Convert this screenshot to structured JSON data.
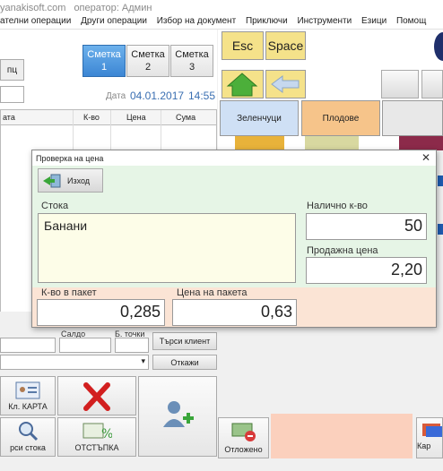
{
  "titlebar": {
    "site": "yanakisoft.com",
    "operator": "оператор: Админ"
  },
  "menu": {
    "items": [
      "ателни операции",
      "Други операции",
      "Избор на документ",
      "Приключи",
      "Инструменти",
      "Езици",
      "Помощ"
    ]
  },
  "left": {
    "pc_button": "пц",
    "accounts": [
      {
        "label": "Сметка",
        "num": "1"
      },
      {
        "label": "Сметка",
        "num": "2"
      },
      {
        "label": "Сметка",
        "num": "3"
      }
    ],
    "date_label": "Дата",
    "date": "04.01.2017",
    "time": "14:55",
    "grid_headers": [
      "ата",
      "К-во",
      "Цена",
      "Сума"
    ]
  },
  "keys": {
    "esc": "Esc",
    "space": "Space"
  },
  "categories": {
    "veg": "Зеленчуци",
    "fruit": "Плодове"
  },
  "dialog": {
    "title": "Проверка на цена",
    "exit_label": "Изход",
    "item_label": "Стока",
    "item_name": "Банани",
    "qty_label": "Налично к-во",
    "qty_value": "50",
    "price_label": "Продажна цена",
    "price_value": "2,20",
    "pack_qty_label": "К-во в пакет",
    "pack_qty_value": "0,285",
    "pack_price_label": "Цена на пакета",
    "pack_price_value": "0,63"
  },
  "client": {
    "saldo_label": "Салдо",
    "points_label": "Б. точки",
    "search_client": "Търси клиент",
    "cancel": "Откажи"
  },
  "bottom": {
    "card_label": "Кл. КАРТА",
    "search_stock": "рси стока",
    "discount": "ОТСТЪПКА",
    "postponed": "Отложено",
    "card_right": "Кар"
  },
  "colors": {
    "accent_blue": "#3c86d4",
    "dialog_bg": "#e6f5e6",
    "key_yellow": "#f5e28a",
    "fruit_orange": "#f6c48a",
    "veg_blue": "#cfe0f5",
    "peach": "#fbd0bd"
  }
}
